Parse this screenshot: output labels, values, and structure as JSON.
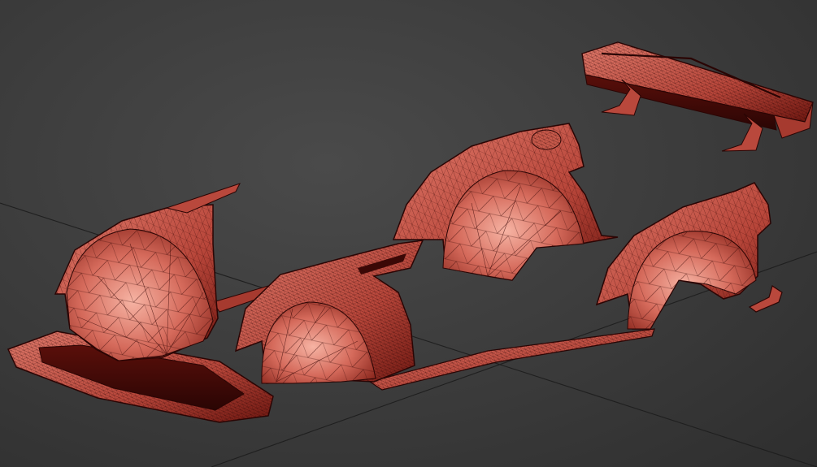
{
  "viewport": {
    "background": "#3b3b3b",
    "grid_color": "#1c1c1c",
    "wire_color": "#2a0705",
    "shade_light": "#f2a89a",
    "shade_mid": "#c9584a",
    "shade_dark": "#7a1a12",
    "objects": [
      "front-bumper-lip-part",
      "front-fender-part",
      "side-skirt-part",
      "door-fender-flare-part",
      "rear-fender-flare-part",
      "rear-quarter-flare-part",
      "small-bracket-part",
      "rear-wing-spoiler-part"
    ]
  }
}
